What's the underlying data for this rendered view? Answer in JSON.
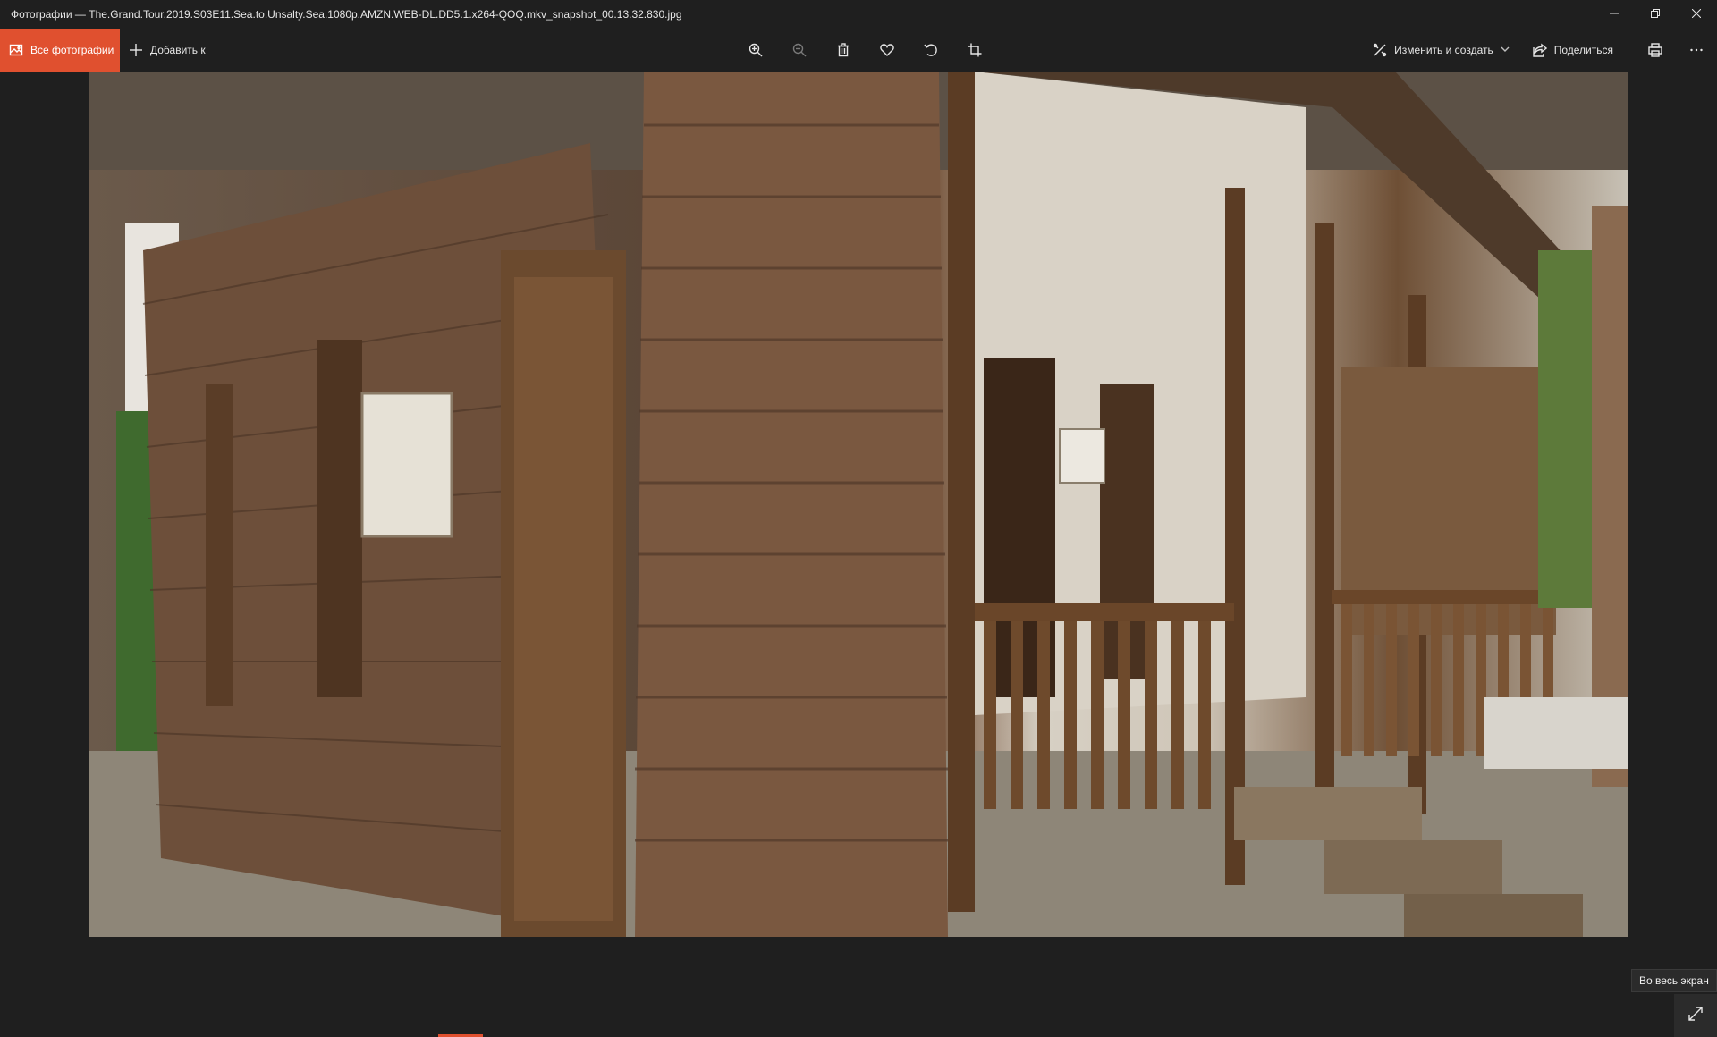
{
  "window": {
    "title": "Фотографии — The.Grand.Tour.2019.S03E11.Sea.to.Unsalty.Sea.1080p.AMZN.WEB-DL.DD5.1.x264-QOQ.mkv_snapshot_00.13.32.830.jpg"
  },
  "toolbar": {
    "all_photos_label": "Все фотографии",
    "add_to_label": "Добавить к",
    "edit_create_label": "Изменить и создать",
    "share_label": "Поделиться"
  },
  "icons": {
    "photos": "photos-app-icon",
    "add": "plus-icon",
    "zoom_in": "zoom-in-icon",
    "zoom_out": "zoom-out-icon",
    "delete": "trash-icon",
    "favorite": "heart-icon",
    "rotate": "rotate-icon",
    "crop": "crop-icon",
    "edit": "edit-create-icon",
    "share": "share-icon",
    "print": "printer-icon",
    "more": "more-icon",
    "fullscreen": "expand-icon"
  },
  "viewer": {
    "fullscreen_tooltip": "Во весь экран"
  },
  "colors": {
    "accent": "#e0502f",
    "background": "#1f1f1f"
  }
}
